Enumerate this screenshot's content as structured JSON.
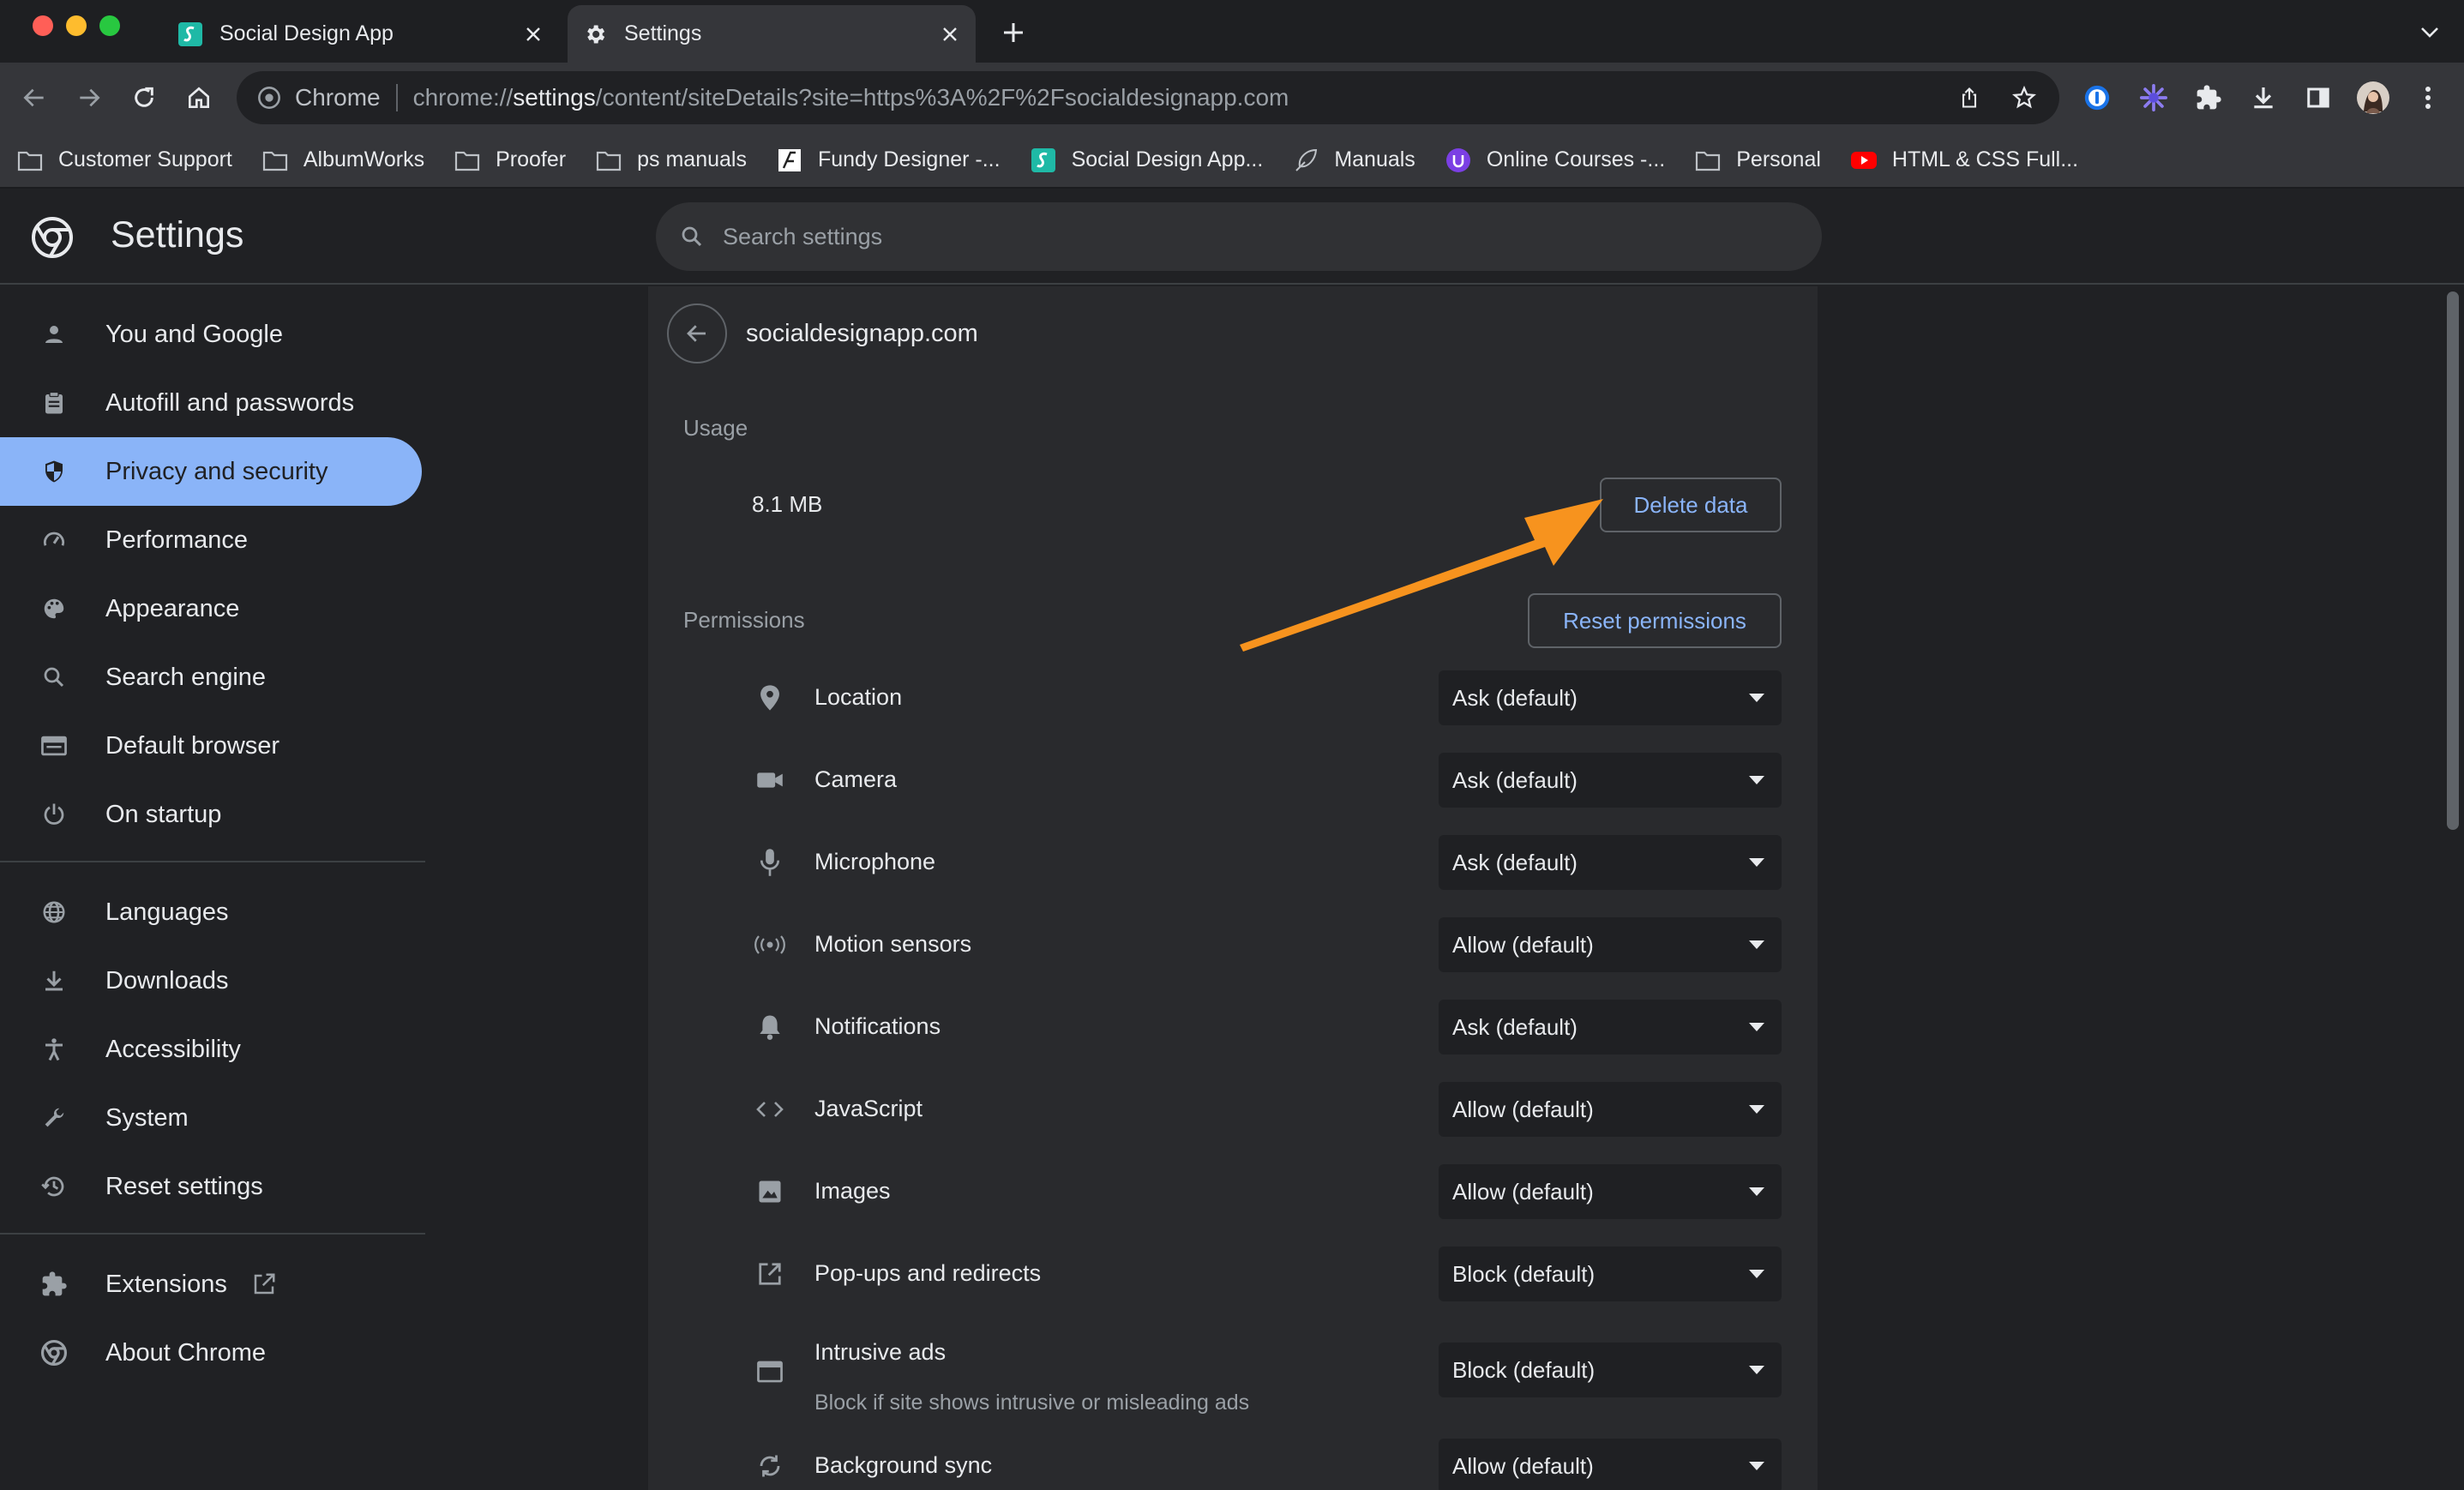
{
  "browser": {
    "tabs": [
      {
        "title": "Social Design App",
        "icon": "social-design-app-favicon"
      },
      {
        "title": "Settings",
        "icon": "gear-icon",
        "active": true
      }
    ],
    "omnibox": {
      "chip": "Chrome",
      "url_scheme": "chrome://",
      "url_host": "settings",
      "url_path": "/content/siteDetails?site=https%3A%2F%2Fsocialdesignapp.com"
    },
    "bookmarks": [
      {
        "label": "Customer Support",
        "icon": "folder-icon"
      },
      {
        "label": "AlbumWorks",
        "icon": "folder-icon"
      },
      {
        "label": "Proofer",
        "icon": "folder-icon"
      },
      {
        "label": "ps manuals",
        "icon": "folder-icon"
      },
      {
        "label": "Fundy Designer -...",
        "icon": "fundy-favicon"
      },
      {
        "label": "Social Design App...",
        "icon": "social-design-app-favicon"
      },
      {
        "label": "Manuals",
        "icon": "feather-favicon"
      },
      {
        "label": "Online Courses -...",
        "icon": "courses-favicon"
      },
      {
        "label": "Personal",
        "icon": "folder-icon"
      },
      {
        "label": "HTML & CSS Full...",
        "icon": "youtube-favicon"
      }
    ]
  },
  "settings": {
    "title": "Settings",
    "search_placeholder": "Search settings"
  },
  "sidebar": {
    "items": [
      {
        "label": "You and Google",
        "icon": "person-icon"
      },
      {
        "label": "Autofill and passwords",
        "icon": "clipboard-icon"
      },
      {
        "label": "Privacy and security",
        "icon": "shield-icon",
        "active": true
      },
      {
        "label": "Performance",
        "icon": "speedometer-icon"
      },
      {
        "label": "Appearance",
        "icon": "palette-icon"
      },
      {
        "label": "Search engine",
        "icon": "search-icon"
      },
      {
        "label": "Default browser",
        "icon": "browser-window-icon"
      },
      {
        "label": "On startup",
        "icon": "power-icon"
      },
      {
        "label": "Languages",
        "icon": "globe-icon"
      },
      {
        "label": "Downloads",
        "icon": "download-icon"
      },
      {
        "label": "Accessibility",
        "icon": "accessibility-icon"
      },
      {
        "label": "System",
        "icon": "wrench-icon"
      },
      {
        "label": "Reset settings",
        "icon": "history-icon"
      },
      {
        "label": "Extensions",
        "icon": "puzzle-icon"
      },
      {
        "label": "About Chrome",
        "icon": "chrome-logo-icon"
      }
    ]
  },
  "site": {
    "title": "socialdesignapp.com",
    "usage_label": "Usage",
    "usage_value": "8.1 MB",
    "delete_label": "Delete data",
    "permissions_label": "Permissions",
    "reset_label": "Reset permissions",
    "permissions": [
      {
        "label": "Location",
        "value": "Ask (default)",
        "icon": "location-pin-icon"
      },
      {
        "label": "Camera",
        "value": "Ask (default)",
        "icon": "camera-icon"
      },
      {
        "label": "Microphone",
        "value": "Ask (default)",
        "icon": "microphone-icon"
      },
      {
        "label": "Motion sensors",
        "value": "Allow (default)",
        "icon": "sensors-icon"
      },
      {
        "label": "Notifications",
        "value": "Ask (default)",
        "icon": "bell-icon"
      },
      {
        "label": "JavaScript",
        "value": "Allow (default)",
        "icon": "code-icon"
      },
      {
        "label": "Images",
        "value": "Allow (default)",
        "icon": "image-icon"
      },
      {
        "label": "Pop-ups and redirects",
        "value": "Block (default)",
        "icon": "open-in-new-icon"
      },
      {
        "label": "Intrusive ads",
        "sublabel": "Block if site shows intrusive or misleading ads",
        "value": "Block (default)",
        "icon": "ad-window-icon"
      },
      {
        "label": "Background sync",
        "value": "Allow (default)",
        "icon": "sync-icon"
      }
    ]
  },
  "colors": {
    "accent": "#8ab4f8",
    "annotation_arrow": "#f7931e",
    "background": "#202124",
    "card": "#292a2d"
  }
}
